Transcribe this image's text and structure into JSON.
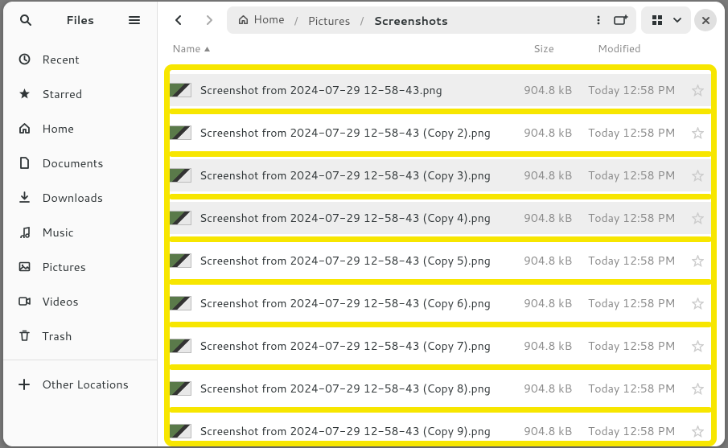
{
  "app": {
    "title": "Files"
  },
  "sidebar": {
    "items": [
      {
        "icon": "clock",
        "label": "Recent"
      },
      {
        "icon": "star",
        "label": "Starred"
      },
      {
        "icon": "home",
        "label": "Home"
      },
      {
        "icon": "doc",
        "label": "Documents"
      },
      {
        "icon": "download",
        "label": "Downloads"
      },
      {
        "icon": "music",
        "label": "Music"
      },
      {
        "icon": "picture",
        "label": "Pictures"
      },
      {
        "icon": "video",
        "label": "Videos"
      },
      {
        "icon": "trash",
        "label": "Trash"
      }
    ],
    "other": {
      "label": "Other Locations"
    }
  },
  "path": {
    "segments": [
      {
        "label": "Home",
        "home": true
      },
      {
        "label": "Pictures"
      },
      {
        "label": "Screenshots",
        "active": true
      }
    ]
  },
  "columns": {
    "name": "Name",
    "size": "Size",
    "modified": "Modified"
  },
  "files": [
    {
      "name": "Screenshot from 2024-07-29 12-58-43.png",
      "size": "904.8 kB",
      "modified": "Today 12:58 PM",
      "selected": true
    },
    {
      "name": "Screenshot from 2024-07-29 12-58-43 (Copy 2).png",
      "size": "904.8 kB",
      "modified": "Today 12:58 PM",
      "selected": false
    },
    {
      "name": "Screenshot from 2024-07-29 12-58-43 (Copy 3).png",
      "size": "904.8 kB",
      "modified": "Today 12:58 PM",
      "selected": true
    },
    {
      "name": "Screenshot from 2024-07-29 12-58-43 (Copy 4).png",
      "size": "904.8 kB",
      "modified": "Today 12:58 PM",
      "selected": true
    },
    {
      "name": "Screenshot from 2024-07-29 12-58-43 (Copy 5).png",
      "size": "904.8 kB",
      "modified": "Today 12:58 PM",
      "selected": false
    },
    {
      "name": "Screenshot from 2024-07-29 12-58-43 (Copy 6).png",
      "size": "904.8 kB",
      "modified": "Today 12:58 PM",
      "selected": false
    },
    {
      "name": "Screenshot from 2024-07-29 12-58-43 (Copy 7).png",
      "size": "904.8 kB",
      "modified": "Today 12:58 PM",
      "selected": false
    },
    {
      "name": "Screenshot from 2024-07-29 12-58-43 (Copy 8).png",
      "size": "904.8 kB",
      "modified": "Today 12:58 PM",
      "selected": false
    },
    {
      "name": "Screenshot from 2024-07-29 12-58-43 (Copy 9).png",
      "size": "904.8 kB",
      "modified": "Today 12:58 PM",
      "selected": false
    }
  ]
}
